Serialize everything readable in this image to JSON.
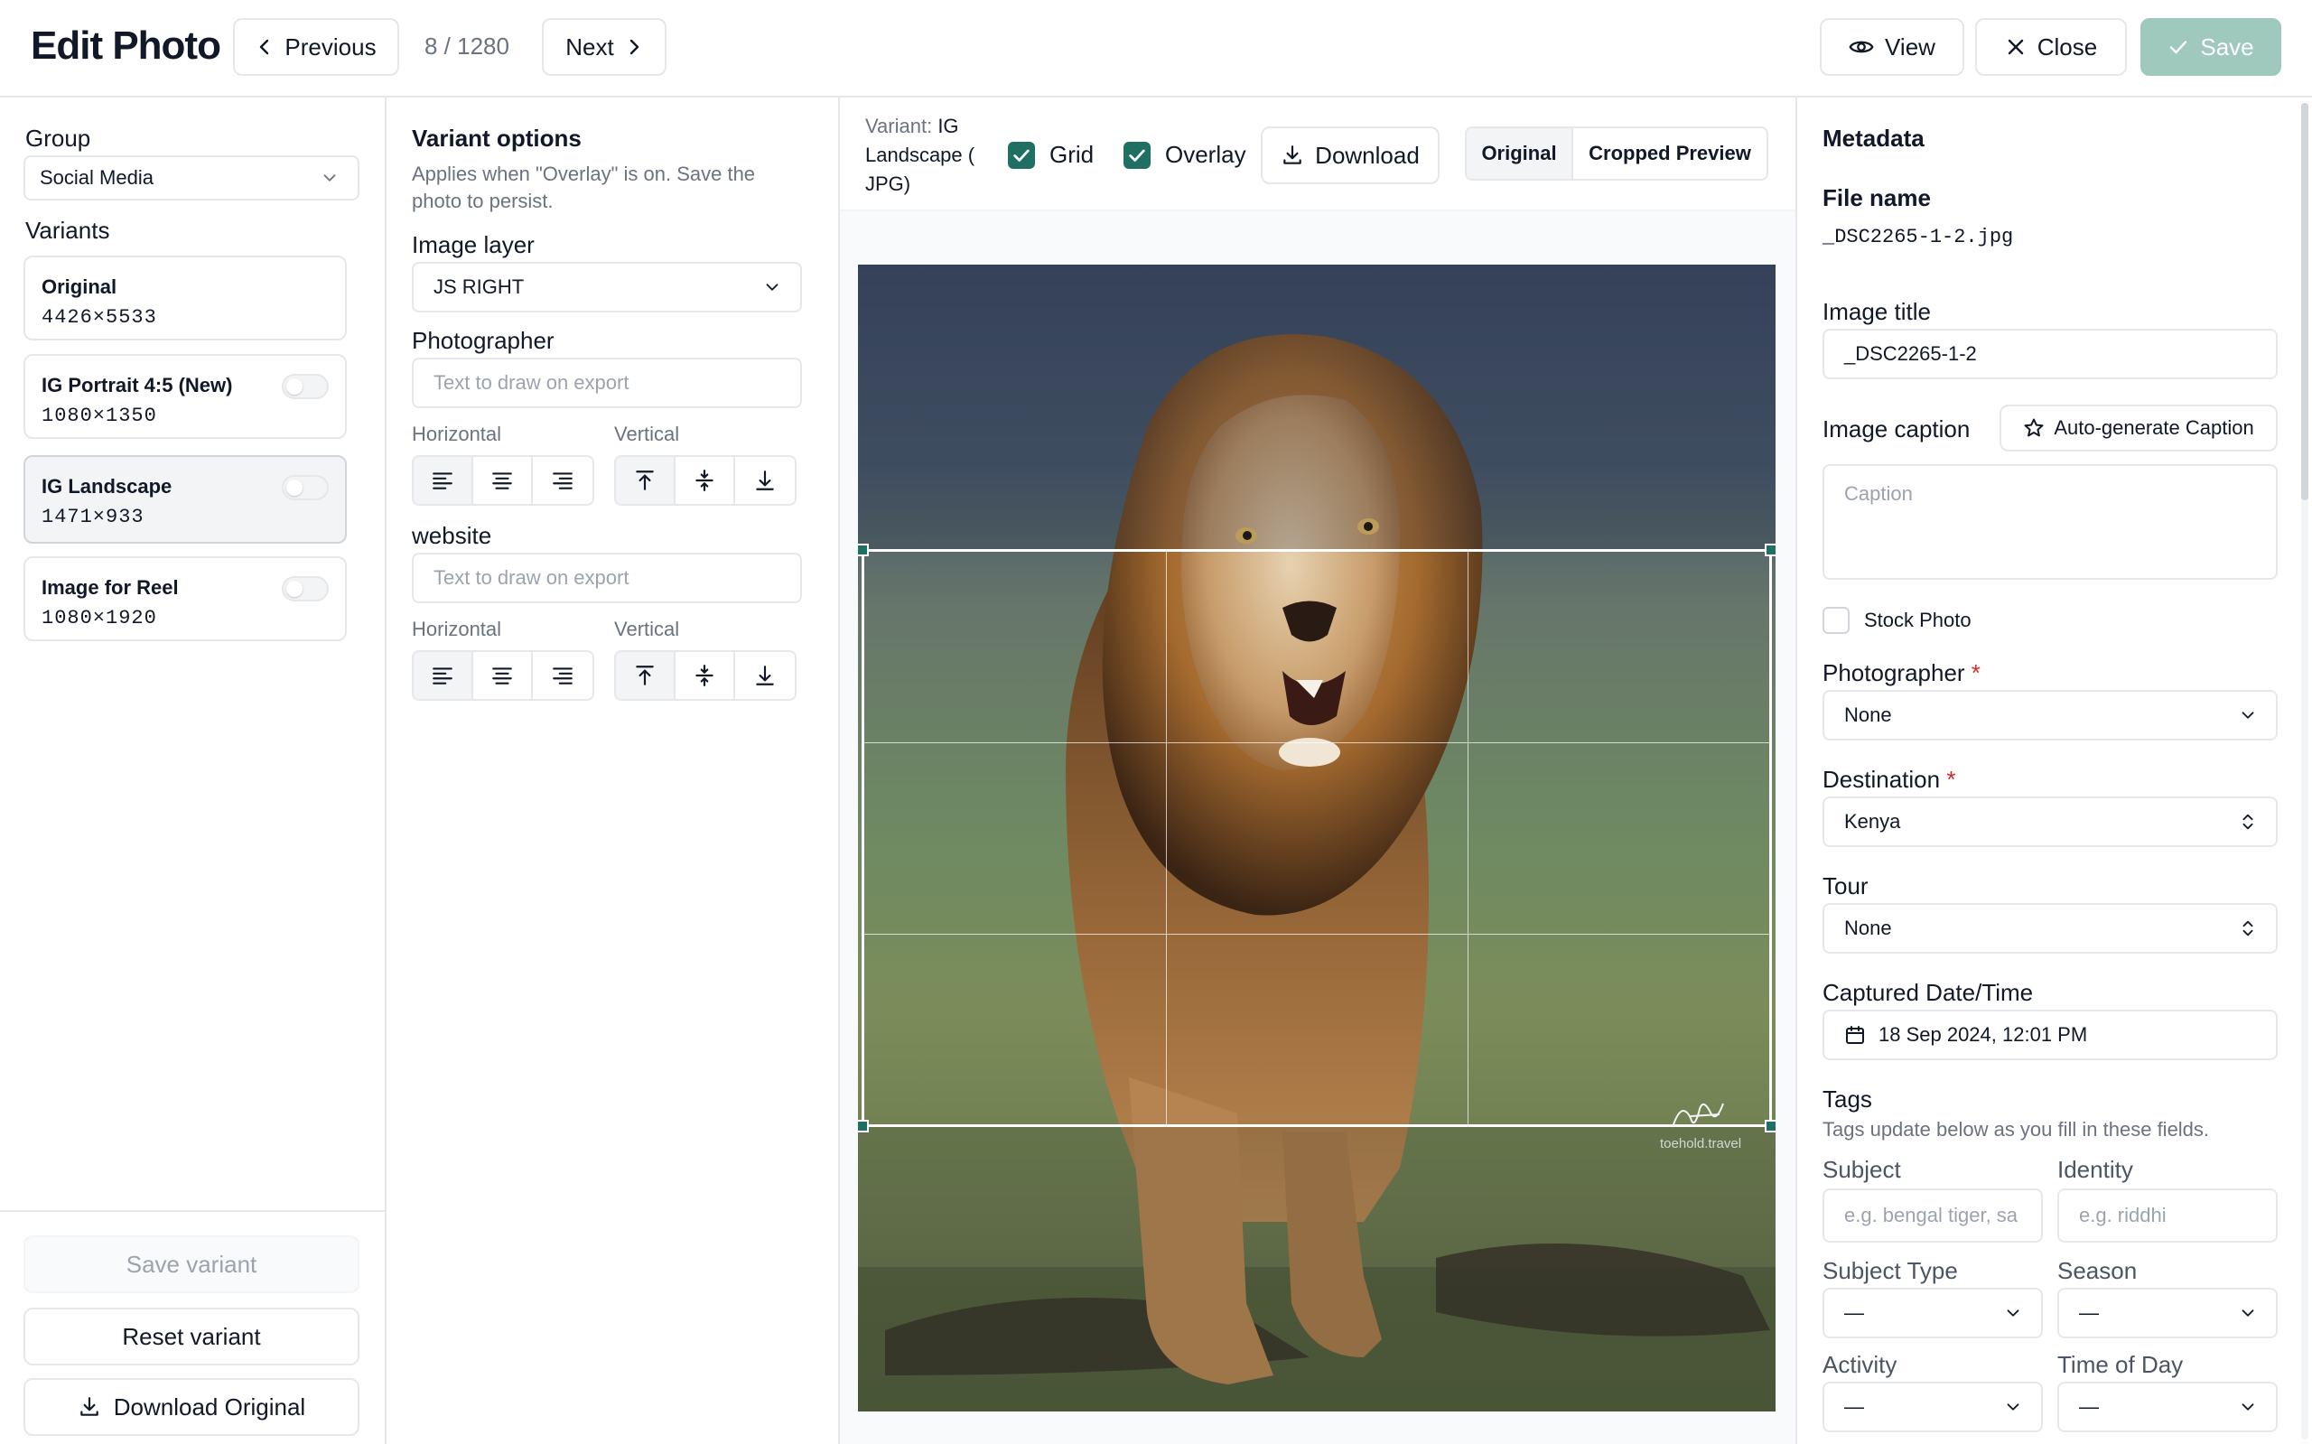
{
  "header": {
    "title": "Edit Photo",
    "previous_label": "Previous",
    "counter": "8 / 1280",
    "next_label": "Next",
    "view_label": "View",
    "close_label": "Close",
    "save_label": "Save"
  },
  "left": {
    "group_label": "Group",
    "group_value": "Social Media",
    "variants_label": "Variants",
    "variants": [
      {
        "name": "Original",
        "dims": "4426×5533",
        "toggle": false
      },
      {
        "name": "IG Portrait 4:5 (New)",
        "dims": "1080×1350",
        "toggle": true
      },
      {
        "name": "IG Landscape",
        "dims": "1471×933",
        "toggle": true
      },
      {
        "name": "Image for Reel",
        "dims": "1080×1920",
        "toggle": true
      }
    ],
    "save_variant": "Save variant",
    "reset_variant": "Reset variant",
    "download_original": "Download Original"
  },
  "options": {
    "title": "Variant options",
    "description_line1": "Applies when \"Overlay\" is on. Save the",
    "description_line2": "photo to persist.",
    "image_layer_label": "Image layer",
    "image_layer_value": "JS RIGHT",
    "photographer_label": "Photographer",
    "photographer_placeholder": "Text to draw on export",
    "website_label": "website",
    "website_placeholder": "Text to draw on export",
    "horizontal_label": "Horizontal",
    "vertical_label": "Vertical"
  },
  "canvas": {
    "variant_prefix": "Variant:",
    "variant_line1": "IG",
    "variant_line2": "Landscape  (",
    "variant_line3": "JPG)",
    "grid_label": "Grid",
    "overlay_label": "Overlay",
    "download_label": "Download",
    "tab_original": "Original",
    "tab_cropped": "Cropped Preview",
    "watermark": "toehold.travel",
    "crop": {
      "grid_rows": 3,
      "grid_cols": 3
    }
  },
  "metadata": {
    "title": "Metadata",
    "file_name_label": "File name",
    "file_name": "_DSC2265-1-2.jpg",
    "image_title_label": "Image title",
    "image_title": "_DSC2265-1-2",
    "caption_label": "Image caption",
    "auto_caption": "Auto-generate Caption",
    "caption_placeholder": "Caption",
    "stock_photo": "Stock Photo",
    "photographer_label": "Photographer",
    "photographer_value": "None",
    "destination_label": "Destination",
    "destination_value": "Kenya",
    "tour_label": "Tour",
    "tour_value": "None",
    "captured_label": "Captured Date/Time",
    "captured_value": "18 Sep 2024, 12:01 PM",
    "tags_label": "Tags",
    "tags_hint": "Tags update below as you fill in these fields.",
    "subject_label": "Subject",
    "subject_placeholder": "e.g. bengal tiger, sa",
    "identity_label": "Identity",
    "identity_placeholder": "e.g. riddhi",
    "subject_type_label": "Subject Type",
    "subject_type_value": "—",
    "season_label": "Season",
    "season_value": "—",
    "activity_label": "Activity",
    "activity_value": "—",
    "time_of_day_label": "Time of Day",
    "time_of_day_value": "—",
    "required_mark": "*"
  },
  "colors": {
    "accent": "#1f6f63",
    "save_disabled": "#9fc9bd",
    "border": "#e5e7eb"
  },
  "icons": [
    "chevron-left-icon",
    "chevron-right-icon",
    "eye-icon",
    "x-icon",
    "check-icon",
    "chevron-down-icon",
    "download-icon",
    "star-icon",
    "calendar-icon",
    "align-left-icon",
    "align-center-icon",
    "align-right-icon",
    "align-top-icon",
    "align-middle-icon",
    "align-bottom-icon",
    "updown-icon"
  ]
}
